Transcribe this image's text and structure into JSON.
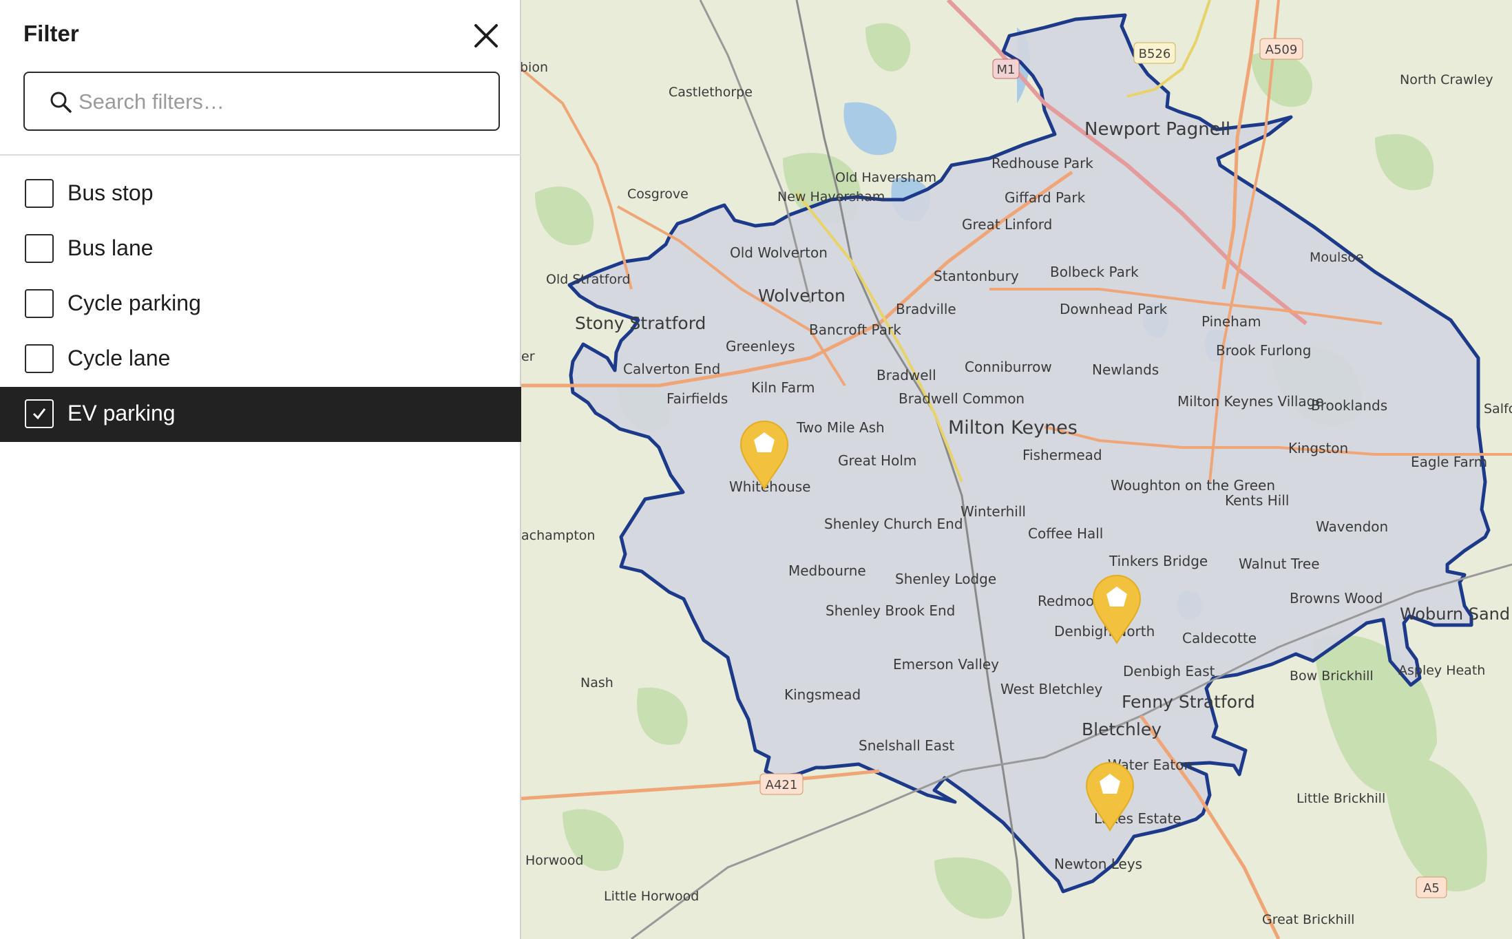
{
  "panel": {
    "title": "Filter",
    "close_icon": "close-icon",
    "search": {
      "placeholder": "Search filters…",
      "value": "",
      "icon": "search-icon"
    },
    "items": [
      {
        "label": "Bus stop",
        "checked": false
      },
      {
        "label": "Bus lane",
        "checked": false
      },
      {
        "label": "Cycle parking",
        "checked": false
      },
      {
        "label": "Cycle lane",
        "checked": false
      },
      {
        "label": "EV parking",
        "checked": true
      }
    ]
  },
  "map": {
    "colors": {
      "boundary": "#1d3a8a",
      "marker": "#f2c13d",
      "selected_row": "#222222"
    },
    "road_labels": {
      "m1": "M1",
      "b526": "B526",
      "a509": "A509",
      "a421": "A421",
      "a5": "A5"
    },
    "places": {
      "bion": "bion",
      "castlethorpe": "Castlethorpe",
      "north_crawley": "North Crawley",
      "newport_pagnell": "Newport Pagnell",
      "redhouse_park": "Redhouse Park",
      "old_haversham": "Old Haversham",
      "cosgrove": "Cosgrove",
      "new_haversham": "New Haversham",
      "giffard_park": "Giffard Park",
      "great_linford": "Great Linford",
      "old_wolverton": "Old Wolverton",
      "moulsoe": "Moulsoe",
      "stantonbury": "Stantonbury",
      "bolbeck_park": "Bolbeck Park",
      "old_stratford": "Old Stratford",
      "wolverton": "Wolverton",
      "bradville": "Bradville",
      "downhead_park": "Downhead Park",
      "pineham": "Pineham",
      "stony_stratford": "Stony Stratford",
      "bancroft_park": "Bancroft Park",
      "brook_furlong": "Brook Furlong",
      "greenleys": "Greenleys",
      "er": "er",
      "calverton_end": "Calverton End",
      "bradwell": "Bradwell",
      "conniburrow": "Conniburrow",
      "newlands": "Newlands",
      "kiln_farm": "Kiln Farm",
      "fairfields": "Fairfields",
      "bradwell_common": "Bradwell Common",
      "mk_village": "Milton Keynes Village",
      "brooklands": "Brooklands",
      "salfo": "Salfo",
      "two_mile_ash": "Two Mile Ash",
      "milton_keynes": "Milton Keynes",
      "kingston": "Kingston",
      "fishermead": "Fishermead",
      "great_holm": "Great Holm",
      "eagle_farm": "Eagle Farm",
      "whitehouse": "Whitehouse",
      "woughton": "Woughton on the Green",
      "kents_hill": "Kents Hill",
      "winterhill": "Winterhill",
      "achampton": "achampton",
      "shenley_church_end": "Shenley Church End",
      "coffee_hall": "Coffee Hall",
      "wavendon": "Wavendon",
      "tinkers_bridge": "Tinkers Bridge",
      "walnut_tree": "Walnut Tree",
      "medbourne": "Medbourne",
      "shenley_lodge": "Shenley Lodge",
      "browns_wood": "Browns Wood",
      "redmoor": "Redmoor",
      "woburn_sands": "Woburn Sand",
      "shenley_brook_end": "Shenley Brook End",
      "denbigh_north": "Denbigh North",
      "caldecotte": "Caldecotte",
      "emerson_valley": "Emerson Valley",
      "denbigh_east": "Denbigh East",
      "aspley_heath": "Aspley Heath",
      "bow_brickhill": "Bow Brickhill",
      "nash": "Nash",
      "west_bletchley": "West Bletchley",
      "fenny_stratford": "Fenny Stratford",
      "kingsmead": "Kingsmead",
      "bletchley": "Bletchley",
      "snelshall_east": "Snelshall East",
      "water_eaton": "Water Eaton",
      "little_brickhill": "Little Brickhill",
      "lakes_estate": "Lakes Estate",
      "horwood": "Horwood",
      "newton_leys": "Newton Leys",
      "little_horwood": "Little Horwood",
      "great_brickhill": "Great Brickhill"
    },
    "markers": [
      {
        "name": "EV parking",
        "icon": "ev-charging-marker-icon"
      },
      {
        "name": "EV parking",
        "icon": "ev-charging-marker-icon"
      },
      {
        "name": "EV parking",
        "icon": "ev-charging-marker-icon"
      }
    ]
  }
}
